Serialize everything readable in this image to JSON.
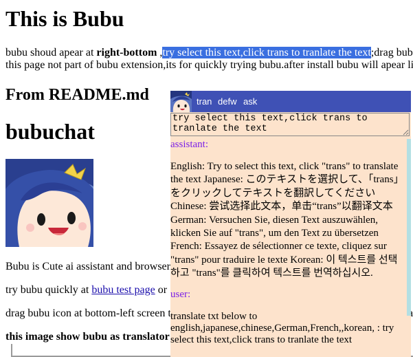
{
  "page": {
    "title": "This is Bubu",
    "intro": {
      "prefix": "bubu shoud apear at ",
      "position": "right-bottom",
      "mid": " ,",
      "selected": "try select this text,click trans to tranlate the text",
      "suffix": ";drag bub"
    },
    "line2": "this page not part of bubu extension,its for quickly trying bubu.after install bubu will apear li",
    "readme_heading": "From README.md",
    "chat_heading": "bubuchat",
    "para1": "Bubu is Cute ai assistant and browser",
    "para2_prefix": "try bubu quickly at ",
    "para2_link": "bubu test page",
    "para2_suffix": " or",
    "para3": "drag bubu icon at bottom-left screen t",
    "para3_tail": "a",
    "para4": "this image show bubu as translator"
  },
  "panel": {
    "toolbar": {
      "tran": "tran",
      "defw": "defw",
      "ask": "ask"
    },
    "input_value": "try select this text,click trans to tranlate the text",
    "assistant_label": "assistant:",
    "assistant_message": "English: Try to select this text, click \"trans\" to translate the text Japanese: このテキストを選択して、「trans」をクリックしてテキストを翻訳してください Chinese: 尝试选择此文本，单击“trans”以翻译文本 German: Versuchen Sie, diesen Text auszuwählen, klicken Sie auf \"trans\", um den Text zu übersetzen French: Essayez de sélectionner ce texte, cliquez sur \"trans\" pour traduire le texte Korean: 이 텍스트를 선택하고 \"trans\"를 클릭하여 텍스트를 번역하십시오.",
    "user_label": "user:",
    "user_message": "translate txt below to english,japanese,chinese,German,French,,korean, : try select this text,click trans to tranlate the text"
  },
  "colors": {
    "toolbar_bg": "#3f51b5",
    "panel_bg": "#fde3cc",
    "role_label": "#7a1fe8",
    "selection": "#3a6fe0",
    "link": "#1a0dab"
  },
  "icons": {
    "avatar": "bubu-avatar-icon",
    "resize": "resize-grip-icon"
  }
}
